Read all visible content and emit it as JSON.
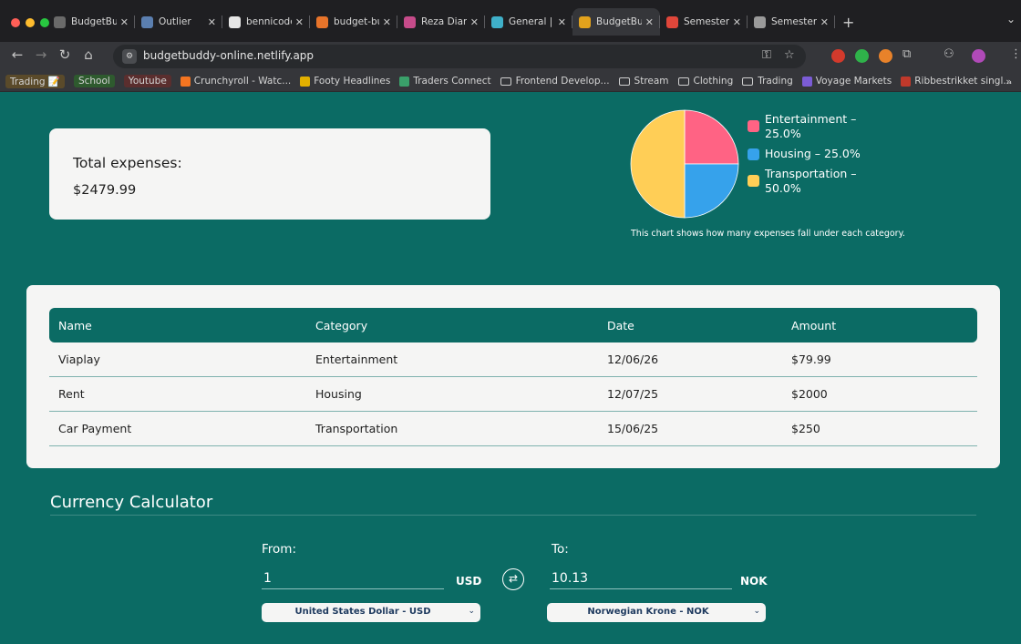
{
  "browser": {
    "tabs": [
      {
        "label": "BudgetBuddy",
        "color": "#6a6a6a"
      },
      {
        "label": "Outlier",
        "color": "#5b7fb0"
      },
      {
        "label": "bennicodes",
        "color": "#e6e6e6"
      },
      {
        "label": "budget-buddy",
        "color": "#e8742a"
      },
      {
        "label": "Reza Diana",
        "color": "#c64b8a"
      },
      {
        "label": "General | P",
        "color": "#3fb0c9"
      },
      {
        "label": "BudgetBuddy",
        "color": "#e2a21c"
      },
      {
        "label": "Semester a",
        "color": "#e0463a"
      },
      {
        "label": "Semester A",
        "color": "#9a9a9a"
      }
    ],
    "url": "budgetbuddy-online.netlify.app",
    "bookmarks": [
      {
        "label": "Trading 📝",
        "style": "pill",
        "bg": "#5a4a2a"
      },
      {
        "label": "School",
        "style": "pill",
        "bg": "#2e5a2e"
      },
      {
        "label": "Youtube",
        "style": "pill",
        "bg": "#5a2e2e"
      },
      {
        "label": "Crunchyroll - Watc...",
        "icon": "#f47521"
      },
      {
        "label": "Footy Headlines",
        "icon": "#e2b000"
      },
      {
        "label": "Traders Connect",
        "icon": "#3aa06a"
      },
      {
        "label": "Frontend Develop...",
        "style": "folder"
      },
      {
        "label": "Stream",
        "style": "folder"
      },
      {
        "label": "Clothing",
        "style": "folder"
      },
      {
        "label": "Trading",
        "style": "folder"
      },
      {
        "label": "Voyage Markets",
        "icon": "#7b5cd6"
      },
      {
        "label": "Ribbestrikket singl...",
        "icon": "#c0392b"
      }
    ]
  },
  "summary": {
    "total_label": "Total expenses:",
    "total_value": "$2479.99"
  },
  "chart_data": {
    "type": "pie",
    "categories": [
      "Entertainment",
      "Housing",
      "Transportation"
    ],
    "values": [
      25.0,
      25.0,
      50.0
    ],
    "legend": [
      "Entertainment – 25.0%",
      "Housing – 25.0%",
      "Transportation – 50.0%"
    ],
    "colors": [
      "#ff6384",
      "#36a2eb",
      "#ffce56"
    ],
    "caption": "This chart shows how many expenses fall under each category."
  },
  "table": {
    "headers": [
      "Name",
      "Category",
      "Date",
      "Amount"
    ],
    "rows": [
      [
        "Viaplay",
        "Entertainment",
        "12/06/26",
        "$79.99"
      ],
      [
        "Rent",
        "Housing",
        "12/07/25",
        "$2000"
      ],
      [
        "Car Payment",
        "Transportation",
        "15/06/25",
        "$250"
      ]
    ]
  },
  "calculator": {
    "title": "Currency Calculator",
    "from": {
      "label": "From:",
      "value": "1",
      "code": "USD",
      "currency": "United States Dollar - USD"
    },
    "to": {
      "label": "To:",
      "value": "10.13",
      "code": "NOK",
      "currency": "Norwegian Krone - NOK"
    }
  }
}
